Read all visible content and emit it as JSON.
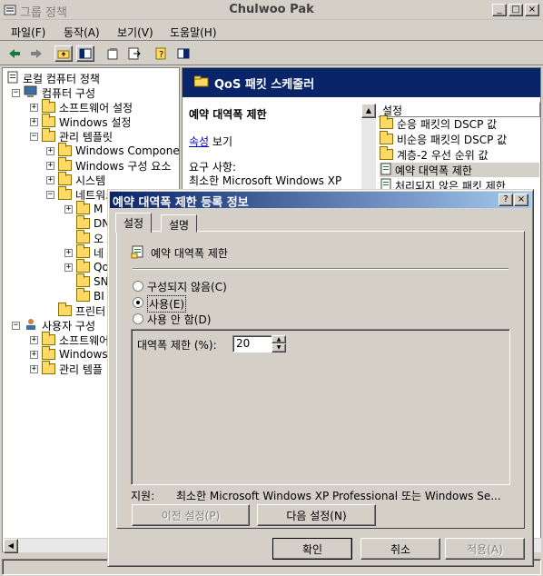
{
  "window": {
    "title": "그룹 정책",
    "owner": "Chulwoo Pak",
    "min_glyph": "_",
    "max_glyph": "□",
    "close_glyph": "×"
  },
  "menu": [
    "파일(F)",
    "동작(A)",
    "보기(V)",
    "도움말(H)"
  ],
  "tree": {
    "root": "로컬 컴퓨터 정책",
    "items": [
      {
        "label": "컴퓨터 구성",
        "level": 1,
        "pm": "−",
        "icon": "computer"
      },
      {
        "label": "소프트웨어 설정",
        "level": 2,
        "pm": "+",
        "icon": "folder"
      },
      {
        "label": "Windows 설정",
        "level": 2,
        "pm": "+",
        "icon": "folder"
      },
      {
        "label": "관리 템플릿",
        "level": 2,
        "pm": "−",
        "icon": "folder"
      },
      {
        "label": "Windows Compone",
        "level": 3,
        "pm": "+",
        "icon": "folder"
      },
      {
        "label": "Windows 구성 요소",
        "level": 3,
        "pm": "+",
        "icon": "folder"
      },
      {
        "label": "시스템",
        "level": 3,
        "pm": "+",
        "icon": "folder"
      },
      {
        "label": "네트워크",
        "level": 3,
        "pm": "−",
        "icon": "folder"
      },
      {
        "label": "M",
        "level": 4,
        "pm": "+",
        "icon": "folder"
      },
      {
        "label": "DN",
        "level": 4,
        "pm": "",
        "icon": "folder"
      },
      {
        "label": "오",
        "level": 4,
        "pm": "",
        "icon": "folder"
      },
      {
        "label": "네",
        "level": 4,
        "pm": "+",
        "icon": "folder"
      },
      {
        "label": "Qo",
        "level": 4,
        "pm": "+",
        "icon": "folder"
      },
      {
        "label": "SN",
        "level": 4,
        "pm": "",
        "icon": "folder"
      },
      {
        "label": "BI",
        "level": 4,
        "pm": "",
        "icon": "folder"
      },
      {
        "label": "프린터",
        "level": 3,
        "pm": "",
        "icon": "folder"
      },
      {
        "label": "사용자 구성",
        "level": 1,
        "pm": "−",
        "icon": "user"
      },
      {
        "label": "소프트웨어",
        "level": 2,
        "pm": "+",
        "icon": "folder"
      },
      {
        "label": "Windows",
        "level": 2,
        "pm": "+",
        "icon": "folder"
      },
      {
        "label": "관리 템플",
        "level": 2,
        "pm": "+",
        "icon": "folder"
      }
    ]
  },
  "right_pane": {
    "header": "QoS 패킷 스케줄러",
    "policy_title": "예약 대역폭 제한",
    "properties_link": "속성",
    "properties_suffix": " 보기",
    "requirements_label": "요구 사항:",
    "requirements_text": "최소한 Microsoft Windows XP",
    "list_header": "설정",
    "list_items": [
      "순응 패킷의 DSCP 값",
      "비순응 패킷의 DSCP 값",
      "계층-2 우선 순위 값",
      "예약 대역폭 제한",
      "처리되지 않은 패킷 제한"
    ]
  },
  "dialog": {
    "title": "예약 대역폭 제한 등록 정보",
    "help_glyph": "?",
    "close_glyph": "×",
    "tabs": [
      "설정",
      "설명"
    ],
    "setting_name": "예약 대역폭 제한",
    "options": {
      "not_configured": "구성되지 않음(C)",
      "enabled": "사용(E)",
      "disabled": "사용 안 함(D)"
    },
    "selected_option": "enabled",
    "bandwidth_label": "대역폭 제한 (%):",
    "bandwidth_value": "20",
    "support_label": "지원:",
    "support_text": "최소한 Microsoft Windows XP Professional 또는 Windows Se...",
    "prev_button": "이전 설정(P)",
    "next_button": "다음 설정(N)",
    "ok_button": "확인",
    "cancel_button": "취소",
    "apply_button": "적용(A)"
  }
}
